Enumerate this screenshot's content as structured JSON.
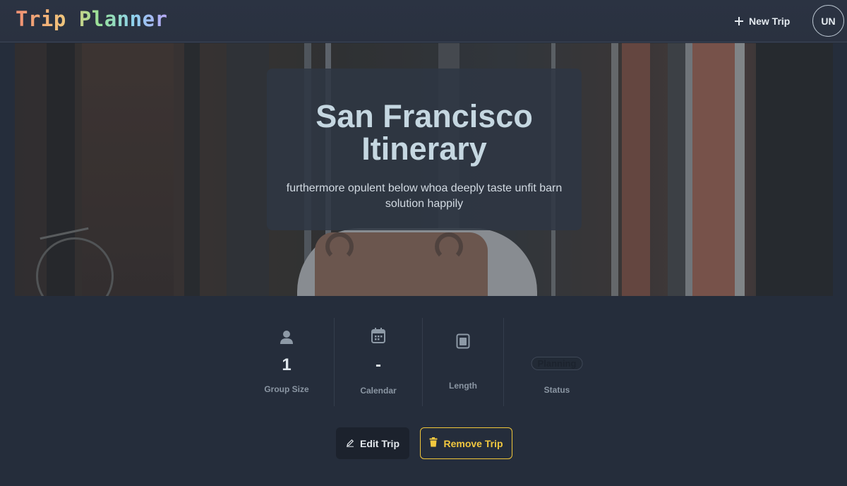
{
  "app": {
    "brand": "Trip Planner",
    "new_trip_label": "New Trip",
    "avatar_initials": "UN"
  },
  "hero": {
    "title": "San Francisco Itinerary",
    "subtitle": "furthermore opulent below whoa deeply taste unfit barn solution happily"
  },
  "stats": {
    "group_size": {
      "value": "1",
      "label": "Group Size",
      "icon": "person-icon"
    },
    "calendar": {
      "value": "-",
      "label": "Calendar",
      "icon": "calendar-icon"
    },
    "length": {
      "value": "",
      "label": "Length",
      "icon": "square-icon"
    },
    "status": {
      "badge": "Planning",
      "label": "Status"
    }
  },
  "actions": {
    "edit_label": "Edit Trip",
    "remove_label": "Remove Trip"
  },
  "colors": {
    "background": "#252d3b",
    "accent_warning": "#f0c63a",
    "text_primary": "#c5d7e1"
  }
}
